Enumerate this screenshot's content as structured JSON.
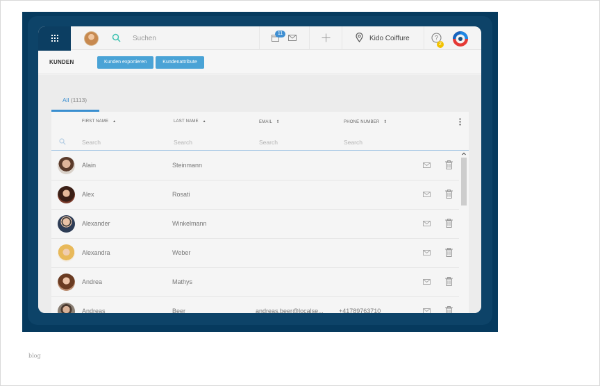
{
  "topbar": {
    "search_label": "Suchen",
    "calendar_badge": "11",
    "location": "Kido Coiffure",
    "help_badge": "2"
  },
  "subbar": {
    "section_label": "KUNDEN",
    "export_button": "Kunden exportieren",
    "attributes_button": "Kundenattribute"
  },
  "tabs": [
    {
      "label": "All",
      "count": "(1113)"
    }
  ],
  "table": {
    "columns": [
      {
        "label": "FIRST NAME",
        "sort": "▲"
      },
      {
        "label": "LAST NAME",
        "sort": "▲"
      },
      {
        "label": "EMAIL",
        "sort": "⇕"
      },
      {
        "label": "PHONE NUMBER",
        "sort": "⇕"
      }
    ],
    "filter_placeholder": "Search",
    "rows": [
      {
        "first": "Alain",
        "last": "Steinmann",
        "email": "",
        "phone": ""
      },
      {
        "first": "Alex",
        "last": "Rosati",
        "email": "",
        "phone": ""
      },
      {
        "first": "Alexander",
        "last": "Winkelmann",
        "email": "",
        "phone": ""
      },
      {
        "first": "Alexandra",
        "last": "Weber",
        "email": "",
        "phone": ""
      },
      {
        "first": "Andrea",
        "last": "Mathys",
        "email": "",
        "phone": ""
      },
      {
        "first": "Andreas",
        "last": "Beer",
        "email": "andreas.beer@localse...",
        "phone": "+41789763710"
      }
    ]
  },
  "icons": {
    "apps": "grid-icon",
    "search": "search-icon",
    "calendar": "calendar-icon",
    "mail": "mail-icon",
    "add": "plus-icon",
    "location": "pin-icon",
    "help": "help-icon",
    "logo": "logo-icon",
    "row_mail": "mail-icon",
    "row_delete": "trash-icon",
    "menu": "kebab-icon"
  },
  "colors": {
    "accent": "#3a8fd0",
    "button": "#4aa3d6",
    "nav_dark": "#0c3e62",
    "frame": "#063a5e",
    "help_badge": "#f2c200"
  },
  "footer": {
    "caption": "blog"
  }
}
